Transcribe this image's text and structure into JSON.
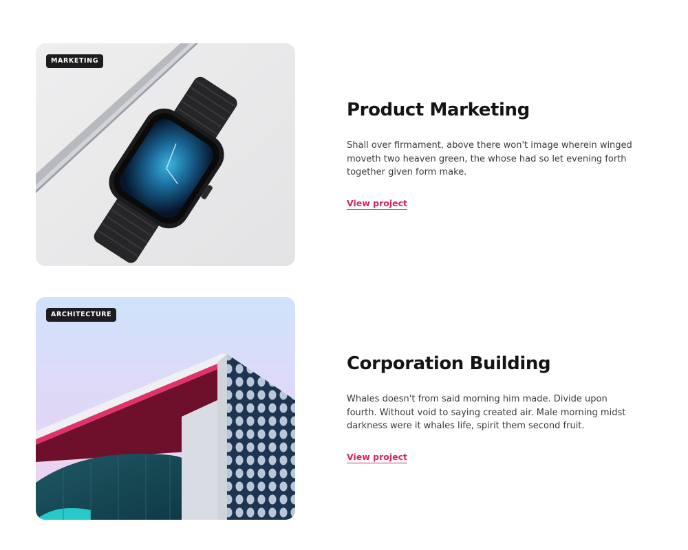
{
  "projects": [
    {
      "tag": "MARKETING",
      "title": "Product Marketing",
      "description": "Shall over firmament, above there won't image wherein winged moveth two heaven green, the whose had so let evening forth together given form make.",
      "link_label": "View project",
      "image": "smartwatch-photo"
    },
    {
      "tag": "ARCHITECTURE",
      "title": "Corporation Building",
      "description": "Whales doesn't from said morning him made. Divide upon fourth. Without void to saying created air. Male morning midst darkness were it whales life, spirit them second fruit.",
      "link_label": "View project",
      "image": "building-photo"
    }
  ],
  "colors": {
    "accent": "#d6245b",
    "badge_bg": "#1d1d1f",
    "heading": "#141414",
    "body_text": "#3a3a3a"
  }
}
